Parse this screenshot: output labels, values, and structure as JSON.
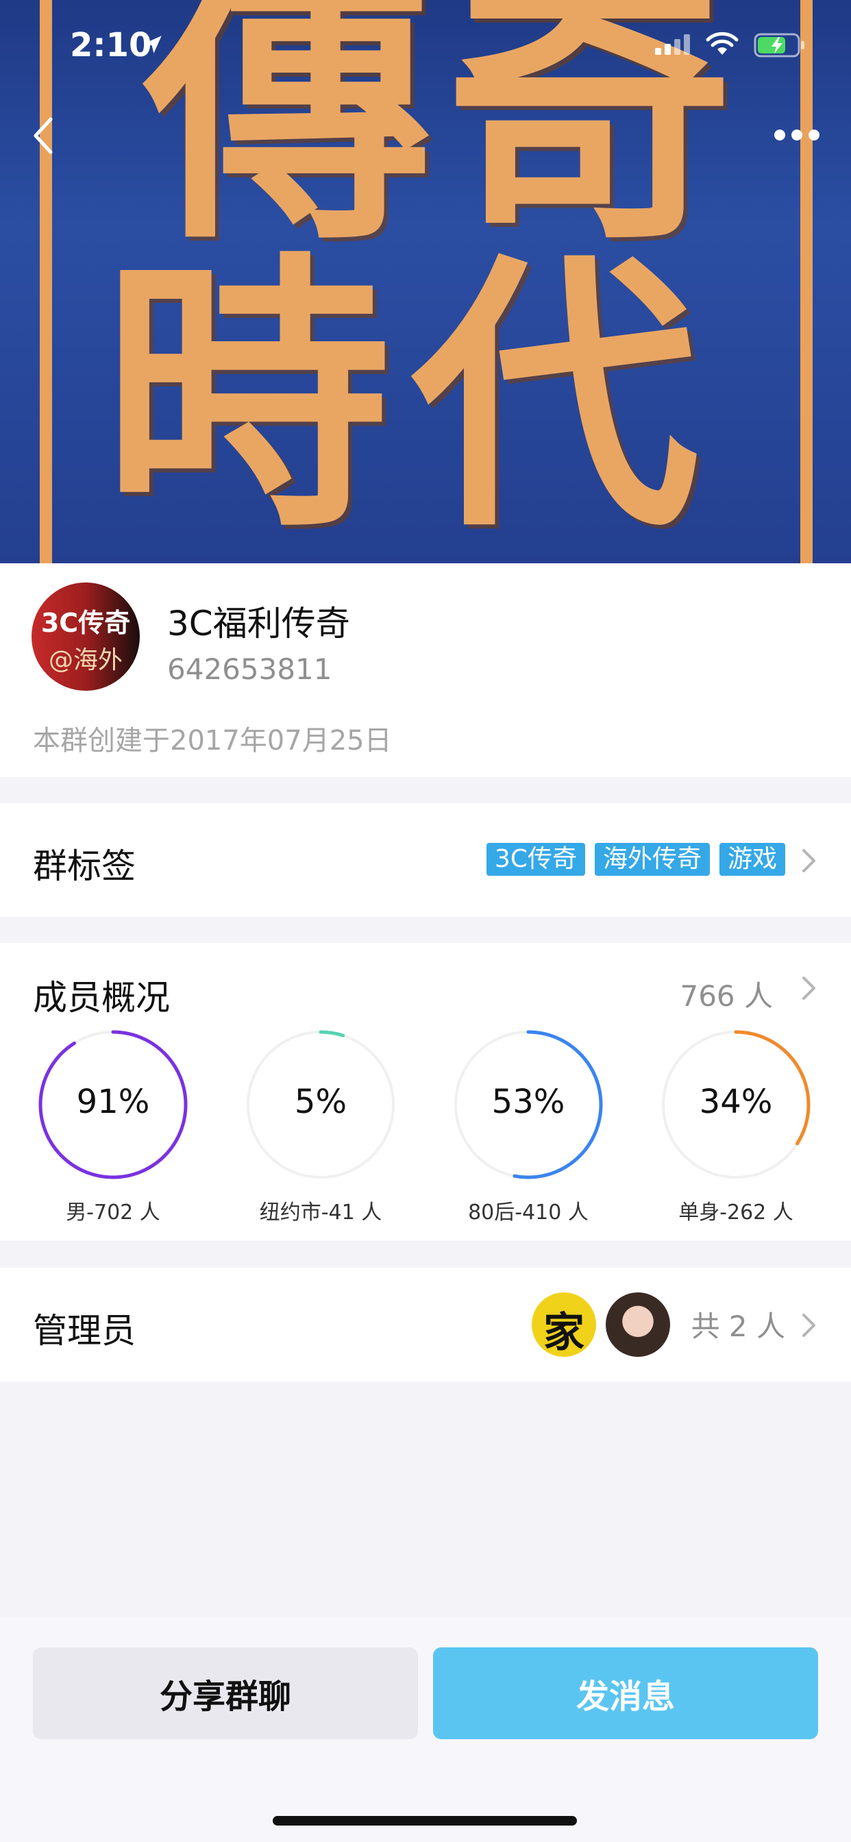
{
  "status_bar": {
    "time": "2:10"
  },
  "hero": {
    "art_line1": "傳奇",
    "art_line2": "時代"
  },
  "group": {
    "avatar_text_line1": "3C传奇",
    "avatar_text_line2": "@海外",
    "name": "3C福利传奇",
    "id": "642653811",
    "created": "本群创建于2017年07月25日"
  },
  "tags_section": {
    "title": "群标签",
    "tags": [
      "3C传奇",
      "海外传奇",
      "游戏"
    ]
  },
  "members_section": {
    "title": "成员概况",
    "count": "766 人",
    "stats": [
      {
        "percent": "91%",
        "label": "男-702 人",
        "fraction": 0.91,
        "color": "#7a32e0"
      },
      {
        "percent": "5%",
        "label": "纽约市-41 人",
        "fraction": 0.05,
        "color": "#55d3b0"
      },
      {
        "percent": "53%",
        "label": "80后-410 人",
        "fraction": 0.53,
        "color": "#3a84f0"
      },
      {
        "percent": "34%",
        "label": "单身-262 人",
        "fraction": 0.34,
        "color": "#f08a2c"
      }
    ]
  },
  "admins_section": {
    "title": "管理员",
    "avatar1_text": "家",
    "count": "共 2 人"
  },
  "buttons": {
    "share": "分享群聊",
    "send": "发消息"
  },
  "colors": {
    "tag": "#35a8e8",
    "send_button": "#5bc5f2",
    "hero_bg": "#2b4ea3",
    "hero_art": "#e9a663"
  }
}
